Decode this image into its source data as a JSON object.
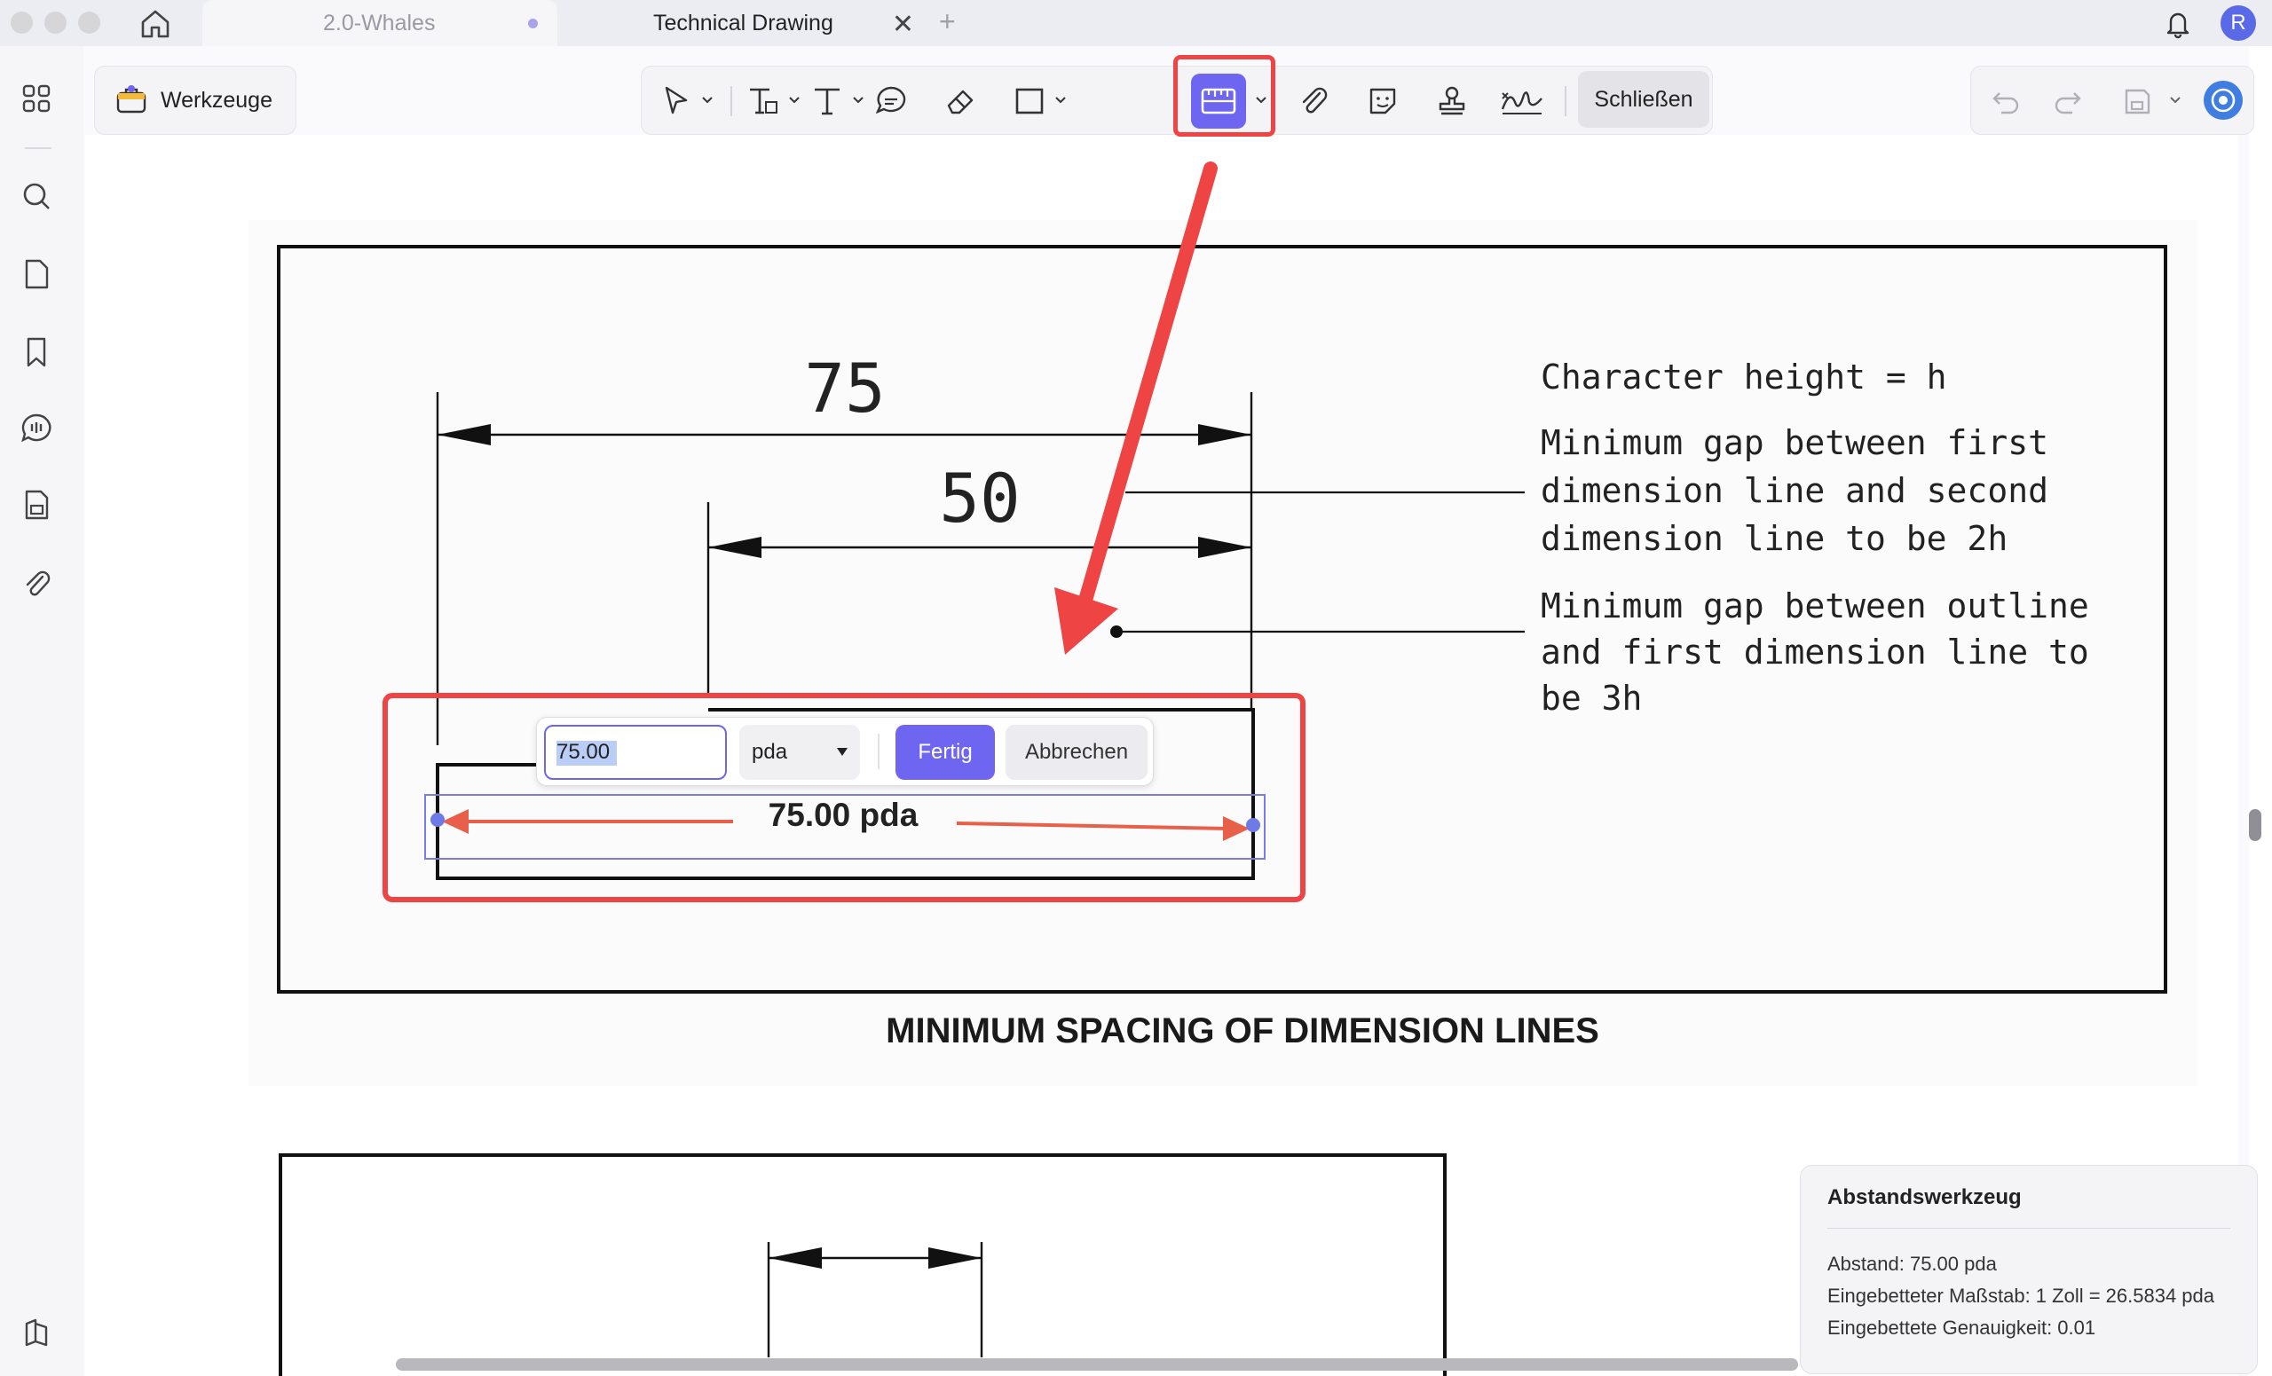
{
  "tabs": [
    {
      "label": "2.0-Whales",
      "modified": true
    },
    {
      "label": "Technical Drawing",
      "active": true
    }
  ],
  "user": {
    "avatar_letter": "R"
  },
  "toolbar": {
    "tools_label": "Werkzeuge",
    "close_label": "Schließen"
  },
  "drawing": {
    "dim_outer": "75",
    "dim_inner": "50",
    "note1": [
      "Character height = h"
    ],
    "note2": [
      "Minimum gap between first",
      "dimension line and second",
      "dimension line to be 2h"
    ],
    "note3": [
      "Minimum gap between outline",
      "and first dimension line to",
      "be 3h"
    ],
    "caption": "MINIMUM SPACING OF DIMENSION LINES"
  },
  "measure": {
    "value": "75.00",
    "unit": "pda",
    "done_label": "Fertig",
    "cancel_label": "Abbrechen",
    "result_label": "75.00 pda"
  },
  "info_panel": {
    "title": "Abstandswerkzeug",
    "distance": "Abstand: 75.00 pda",
    "scale": "Eingebetteter Maßstab: 1 Zoll = 26.5834 pda",
    "precision": "Eingebettete Genauigkeit: 0.01"
  },
  "colors": {
    "accent": "#6e66f0",
    "highlight": "#ee4444",
    "measure_line": "#e8604a"
  }
}
